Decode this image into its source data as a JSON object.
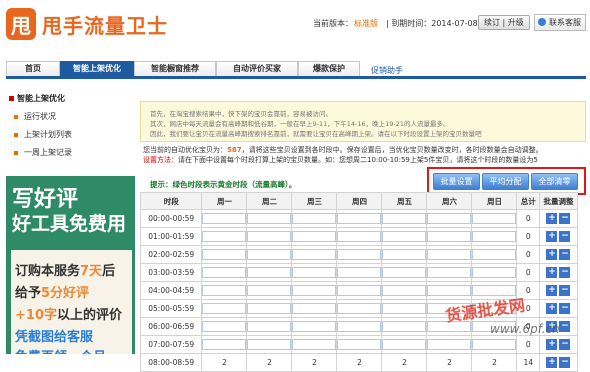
{
  "header": {
    "logo_char": "甩",
    "brand": "甩手流量卫士",
    "version_label": "当前版本：",
    "version_value": "标准版",
    "expiry": "| 到期时间：2014-07-08",
    "renew_button": "续订 | 升级",
    "contact_button": "联系客服"
  },
  "nav": {
    "tabs": [
      "首页",
      "智能上架优化",
      "智能橱窗推荐",
      "自动评价买家",
      "爆款保护",
      "促销助手"
    ]
  },
  "sidebar": {
    "title": "智能上架优化",
    "items": [
      "运行状况",
      "上架计划列表",
      "一周上架记录"
    ]
  },
  "promo": {
    "line1": "写好评",
    "line2": "好工具免费用",
    "l3a": "订购本服务",
    "l3b": "7天",
    "l3c": "后",
    "l4a": "给予",
    "l4b": "5分好评",
    "l5a": "+10字",
    "l5b": "以上的评价",
    "l6": "凭截图给客服",
    "l7": "免费再领一个月"
  },
  "notice": {
    "line1": "首先，在淘宝搜索结果中，快下架的宝贝会靠前，容易被访问。",
    "line2": "其次，网店中每天流量会有高峰期和低谷期，一般在早上9-11，下午14-16，晚上19-21的人流量最多。",
    "line3": "因此，我们要让宝贝在流量高峰期搜索排名靠前，就需要让宝贝在高峰期上架。请在以下时段设置上架的宝贝数量吧"
  },
  "optimize": {
    "prefix": "您当前的自动优化宝贝为：",
    "count": "587",
    "suffix": "，请将这些宝贝设置到各时段中。保存设置后，当优化宝贝数量改变时，各时段数量会自动调整。"
  },
  "setting": {
    "label": "设置方法：",
    "text": "请在下面中设置每个时段打算上架的宝贝数量。如：您想周二10:00-10:59上架5件宝贝，请将这个时段的数量设为5"
  },
  "tip": "提示：绿色时段表示黄金时段（流量高峰）。",
  "buttons": {
    "batch": "批量设置",
    "average": "平均分配",
    "clear": "全部清零"
  },
  "table": {
    "headers": [
      "时段",
      "周一",
      "周二",
      "周三",
      "周四",
      "周五",
      "周六",
      "周日",
      "总计",
      "批量调整"
    ],
    "rows": [
      {
        "slot": "00:00-00:59",
        "total": "0"
      },
      {
        "slot": "01:00-01:59",
        "total": "0"
      },
      {
        "slot": "02:00-02:59",
        "total": "0"
      },
      {
        "slot": "03:00-03:59",
        "total": "0"
      },
      {
        "slot": "04:00-04:59",
        "total": "0"
      },
      {
        "slot": "05:00-05:59",
        "total": "0"
      },
      {
        "slot": "06:00-06:59",
        "total": "0"
      },
      {
        "slot": "07:00-07:59",
        "total": "0"
      },
      {
        "slot": "08:00-08:59",
        "total": "14",
        "days": [
          "2",
          "2",
          "2",
          "2",
          "2",
          "2",
          "2"
        ]
      }
    ],
    "plus": "+",
    "minus": "−"
  },
  "watermark": {
    "line1": "货源批发网",
    "line2": "www.6pf.cn"
  }
}
